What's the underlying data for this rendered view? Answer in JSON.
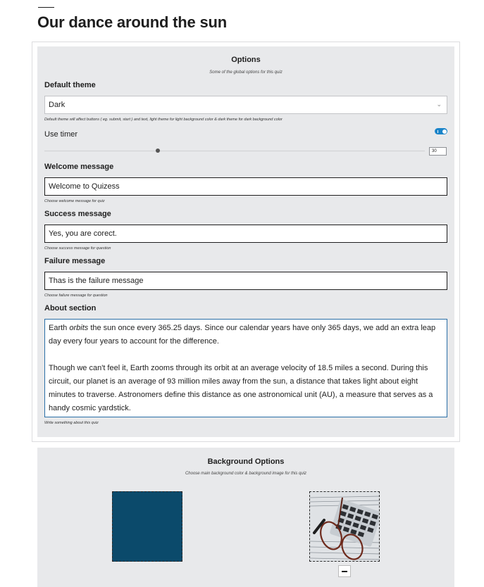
{
  "page": {
    "title": "Our dance around the sun"
  },
  "options": {
    "title": "Options",
    "subtitle": "Some of the global options for this quiz",
    "theme": {
      "label": "Default theme",
      "selected": "Dark",
      "help": "Default theme will affect buttons ( eg. submit, start ) and text, light theme for light background color & dark theme for dark background color"
    },
    "timer": {
      "label": "Use timer",
      "enabled": true,
      "value": "30"
    },
    "welcome": {
      "label": "Welcome message",
      "value": "Welcome to Quizess",
      "help": "Choose welcome message for quiz"
    },
    "success": {
      "label": "Success message",
      "value": "Yes, you are corect.",
      "help": "Choose success message for question"
    },
    "failure": {
      "label": "Failure message",
      "value": "Thas is the failure message",
      "help": "Choose failure message for question"
    },
    "about": {
      "label": "About section",
      "p1_before": "Earth ",
      "p1_em": "orbits",
      "p1_after": " the sun once every 365.25 days. Since our calendar years have only 365 days, we add an extra leap day every four years to account for the difference.",
      "p2": "Though we can't feel it, Earth zooms through its orbit at an average velocity of 18.5 miles a second. During this circuit, our planet is an average of 93 million miles away from the sun, a distance that takes light about eight minutes to traverse. Astronomers define this distance as one astronomical unit (AU), a measure that serves as a handy cosmic yardstick.",
      "help": "Write something about this quiz"
    }
  },
  "background": {
    "title": "Background Options",
    "subtitle": "Choose main background color & background image for this quiz",
    "color": "#0b4a6b"
  },
  "icons": {
    "select_chevron": "chevron-down-icon",
    "remove_image": "minus-icon"
  }
}
